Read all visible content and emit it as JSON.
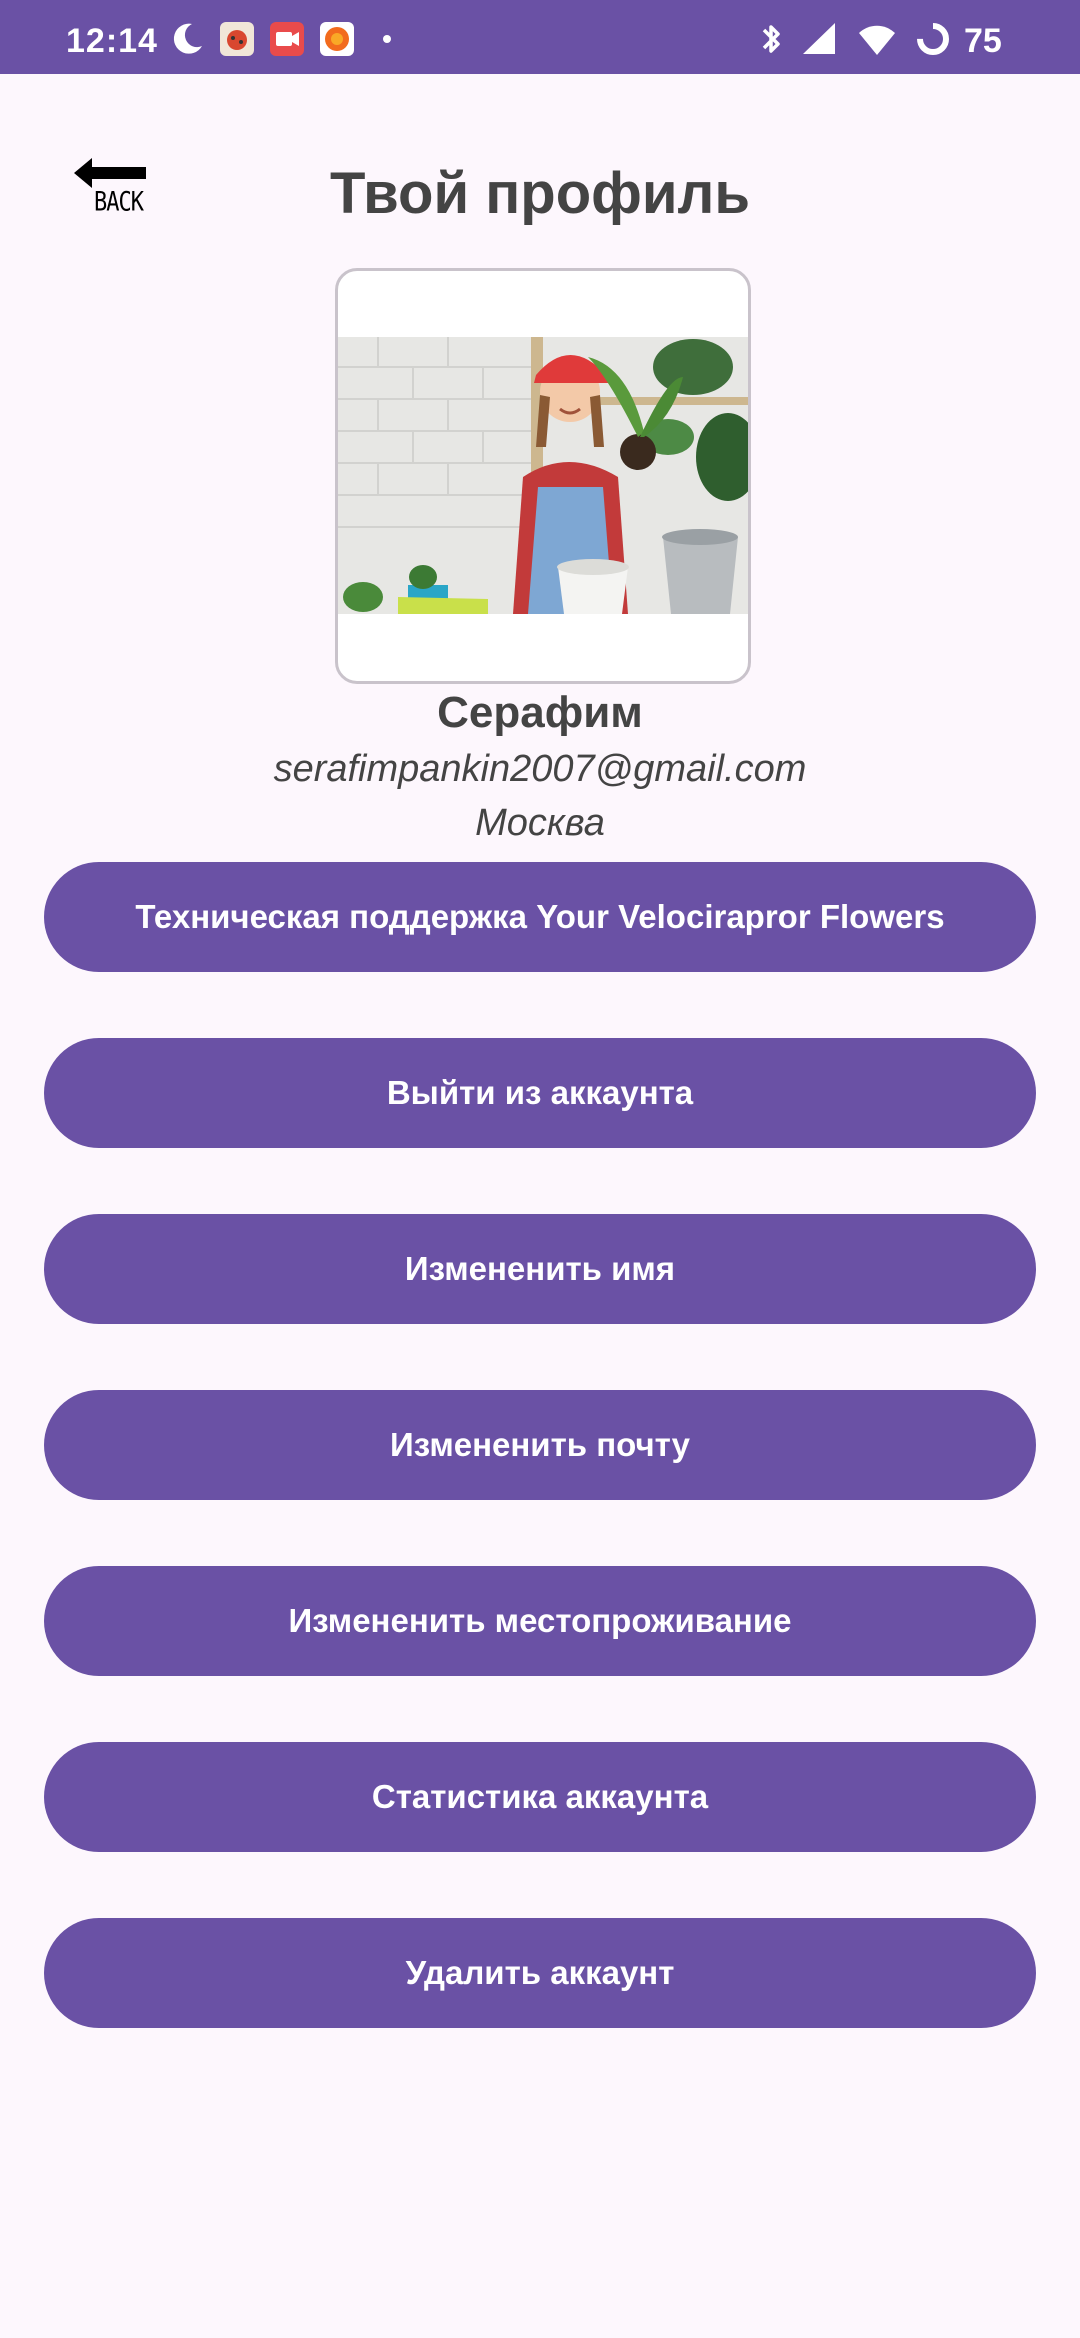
{
  "status_bar": {
    "time": "12:14",
    "battery": "75",
    "icons": [
      "moon-icon",
      "ladybug-app-icon",
      "video-app-icon",
      "orange-app-icon",
      "dot-icon",
      "bluetooth-icon",
      "signal-icon",
      "wifi-icon",
      "battery-ring-icon"
    ]
  },
  "header": {
    "back_label": "BACK",
    "title": "Твой профиль"
  },
  "profile": {
    "name": "Серафим",
    "email": "serafimpankin2007@gmail.com",
    "city": "Москва"
  },
  "buttons": [
    "Техническая поддержка Your Velocirapror Flowers",
    "Выйти из аккаунта",
    "Измененить имя",
    "Измененить почту",
    "Измененить местопроживание",
    "Статистика аккаунта",
    "Удалить аккаунт"
  ],
  "colors": {
    "accent": "#6a51a5",
    "background": "#fdf7fd",
    "text": "#444444"
  }
}
